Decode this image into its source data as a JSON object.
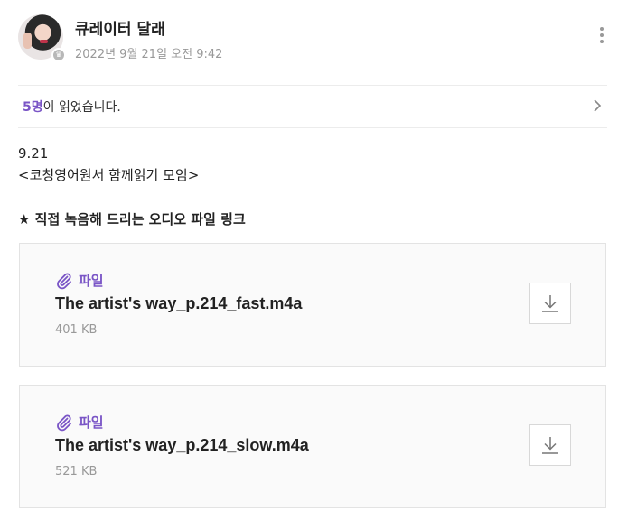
{
  "post": {
    "author": "큐레이터 달래",
    "date": "2022년 9월 21일 오전 9:42"
  },
  "readers": {
    "count": "5명",
    "suffix": "이 읽었습니다."
  },
  "content": {
    "line1": "9.21",
    "line2": "<코칭영어원서 함께읽기 모임>",
    "link_heading": "★ 직접 녹음해 드리는 오디오 파일 링크"
  },
  "files": [
    {
      "label": "파일",
      "name": "The artist's way_p.214_fast.m4a",
      "size": "401 KB"
    },
    {
      "label": "파일",
      "name": "The artist's way_p.214_slow.m4a",
      "size": "521 KB"
    }
  ],
  "colors": {
    "accent": "#7a55c6",
    "muted": "#999999",
    "card_bg": "#fafafa"
  },
  "icons": {
    "more": "vertical-dots-icon",
    "chevron": "chevron-right-icon",
    "clip": "paperclip-icon",
    "download": "download-icon",
    "badge": "crown-icon"
  }
}
